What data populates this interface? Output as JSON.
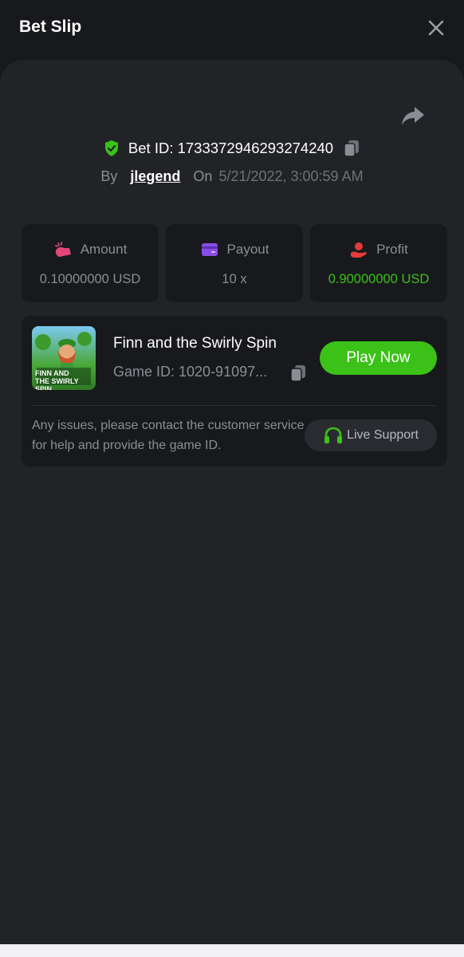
{
  "header": {
    "title": "Bet Slip"
  },
  "bet": {
    "id_text": "Bet ID: 1733372946293274240",
    "by_label": "By",
    "username": "jlegend",
    "on_label": "On",
    "date": "5/21/2022, 3:00:59 AM"
  },
  "stats": [
    {
      "label": "Amount",
      "value": "0.10000000 USD",
      "icon": "amount-icon",
      "color": "#e2477a"
    },
    {
      "label": "Payout",
      "value": "10 x",
      "icon": "payout-card-icon",
      "color": "#8a4be8"
    },
    {
      "label": "Profit",
      "value": "0.90000000 USD",
      "icon": "profit-hand-icon",
      "color": "#e53a3a"
    }
  ],
  "game": {
    "name": "Finn and the Swirly Spin",
    "id_text": "Game ID: 1020-91097...",
    "thumb_text": "FINN AND THE SWIRLY SPIN",
    "play_label": "Play Now",
    "note": "Any issues, please contact the customer service for help and provide the game ID.",
    "support_label": "Live Support"
  },
  "colors": {
    "accent": "#3bc117",
    "background": "#18191c",
    "panel": "#222327"
  }
}
